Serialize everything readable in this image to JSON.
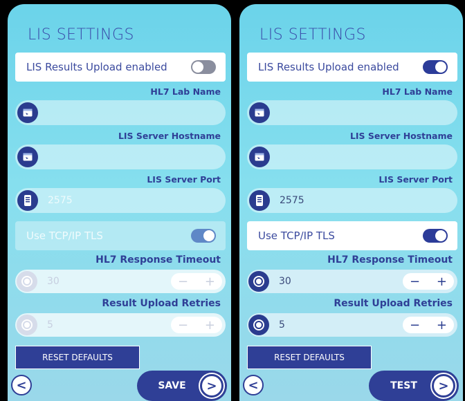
{
  "title": "LIS SETTINGS",
  "colors": {
    "accent": "#2f3f96",
    "toggle_off": "#8a8e9e",
    "toggle_on": "#2c3c99"
  },
  "icons": {
    "field": "window-icon",
    "port": "server-icon",
    "stepper": "timer-icon",
    "back": "chevron-left-icon",
    "next": "chevron-right-icon"
  },
  "labels": {
    "upload_enabled": "LIS Results Upload enabled",
    "lab_name": "HL7 Lab Name",
    "hostname": "LIS Server Hostname",
    "port": "LIS Server Port",
    "tls": "Use TCP/IP TLS",
    "timeout": "HL7 Response Timeout",
    "retries": "Result Upload Retries",
    "reset": "RESET DEFAULTS",
    "minus": "−",
    "plus": "+",
    "back": "<",
    "next": ">"
  },
  "left": {
    "upload_enabled": false,
    "lab_name_value": "",
    "hostname_value": "",
    "port_value": "2575",
    "tls_enabled": true,
    "timeout_value": "30",
    "retries_value": "5",
    "action_label": "SAVE"
  },
  "right": {
    "upload_enabled": true,
    "lab_name_value": "",
    "hostname_value": "",
    "port_value": "2575",
    "tls_enabled": true,
    "timeout_value": "30",
    "retries_value": "5",
    "action_label": "TEST"
  }
}
